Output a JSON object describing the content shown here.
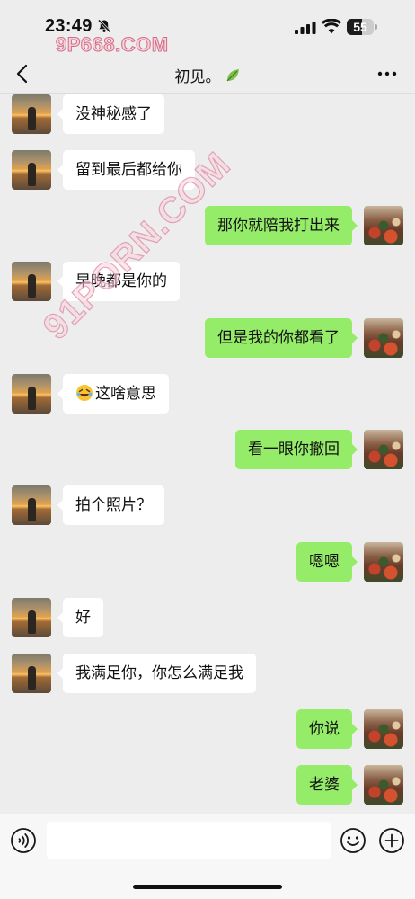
{
  "status_bar": {
    "time": "23:49",
    "battery": "55",
    "battery_level": 0.55,
    "watermark": "9P668.COM",
    "icons": [
      "bell-slash-icon",
      "signal-icon",
      "wifi-icon",
      "battery-icon"
    ]
  },
  "nav": {
    "title": "初见。",
    "icons": [
      "back-chevron-icon",
      "leaf-icon",
      "more-dots-icon"
    ]
  },
  "watermark_diagonal": "91PORN.COM",
  "messages": [
    {
      "side": "left",
      "text": "没神秘感了"
    },
    {
      "side": "left",
      "text": "留到最后都给你"
    },
    {
      "side": "right",
      "text": "那你就陪我打出来"
    },
    {
      "side": "left",
      "text": "早晚都是你的"
    },
    {
      "side": "right",
      "text": "但是我的你都看了"
    },
    {
      "side": "left",
      "text": "这啥意思",
      "emoji": "rolling-laugh-emoji-icon"
    },
    {
      "side": "right",
      "text": "看一眼你撤回"
    },
    {
      "side": "left",
      "text": "拍个照片？"
    },
    {
      "side": "right",
      "text": "嗯嗯"
    },
    {
      "side": "left",
      "text": "好"
    },
    {
      "side": "left",
      "text": "我满足你，你怎么满足我"
    },
    {
      "side": "right",
      "text": "你说"
    },
    {
      "side": "right",
      "text": "老婆"
    }
  ],
  "input_bar": {
    "placeholder": "",
    "value": "",
    "icons": [
      "voice-icon",
      "emoji-face-icon",
      "plus-circle-icon"
    ]
  },
  "colors": {
    "background": "#ededed",
    "bubble_self": "#95ec69",
    "bubble_other": "#ffffff",
    "watermark_stroke": "#d66a86"
  }
}
